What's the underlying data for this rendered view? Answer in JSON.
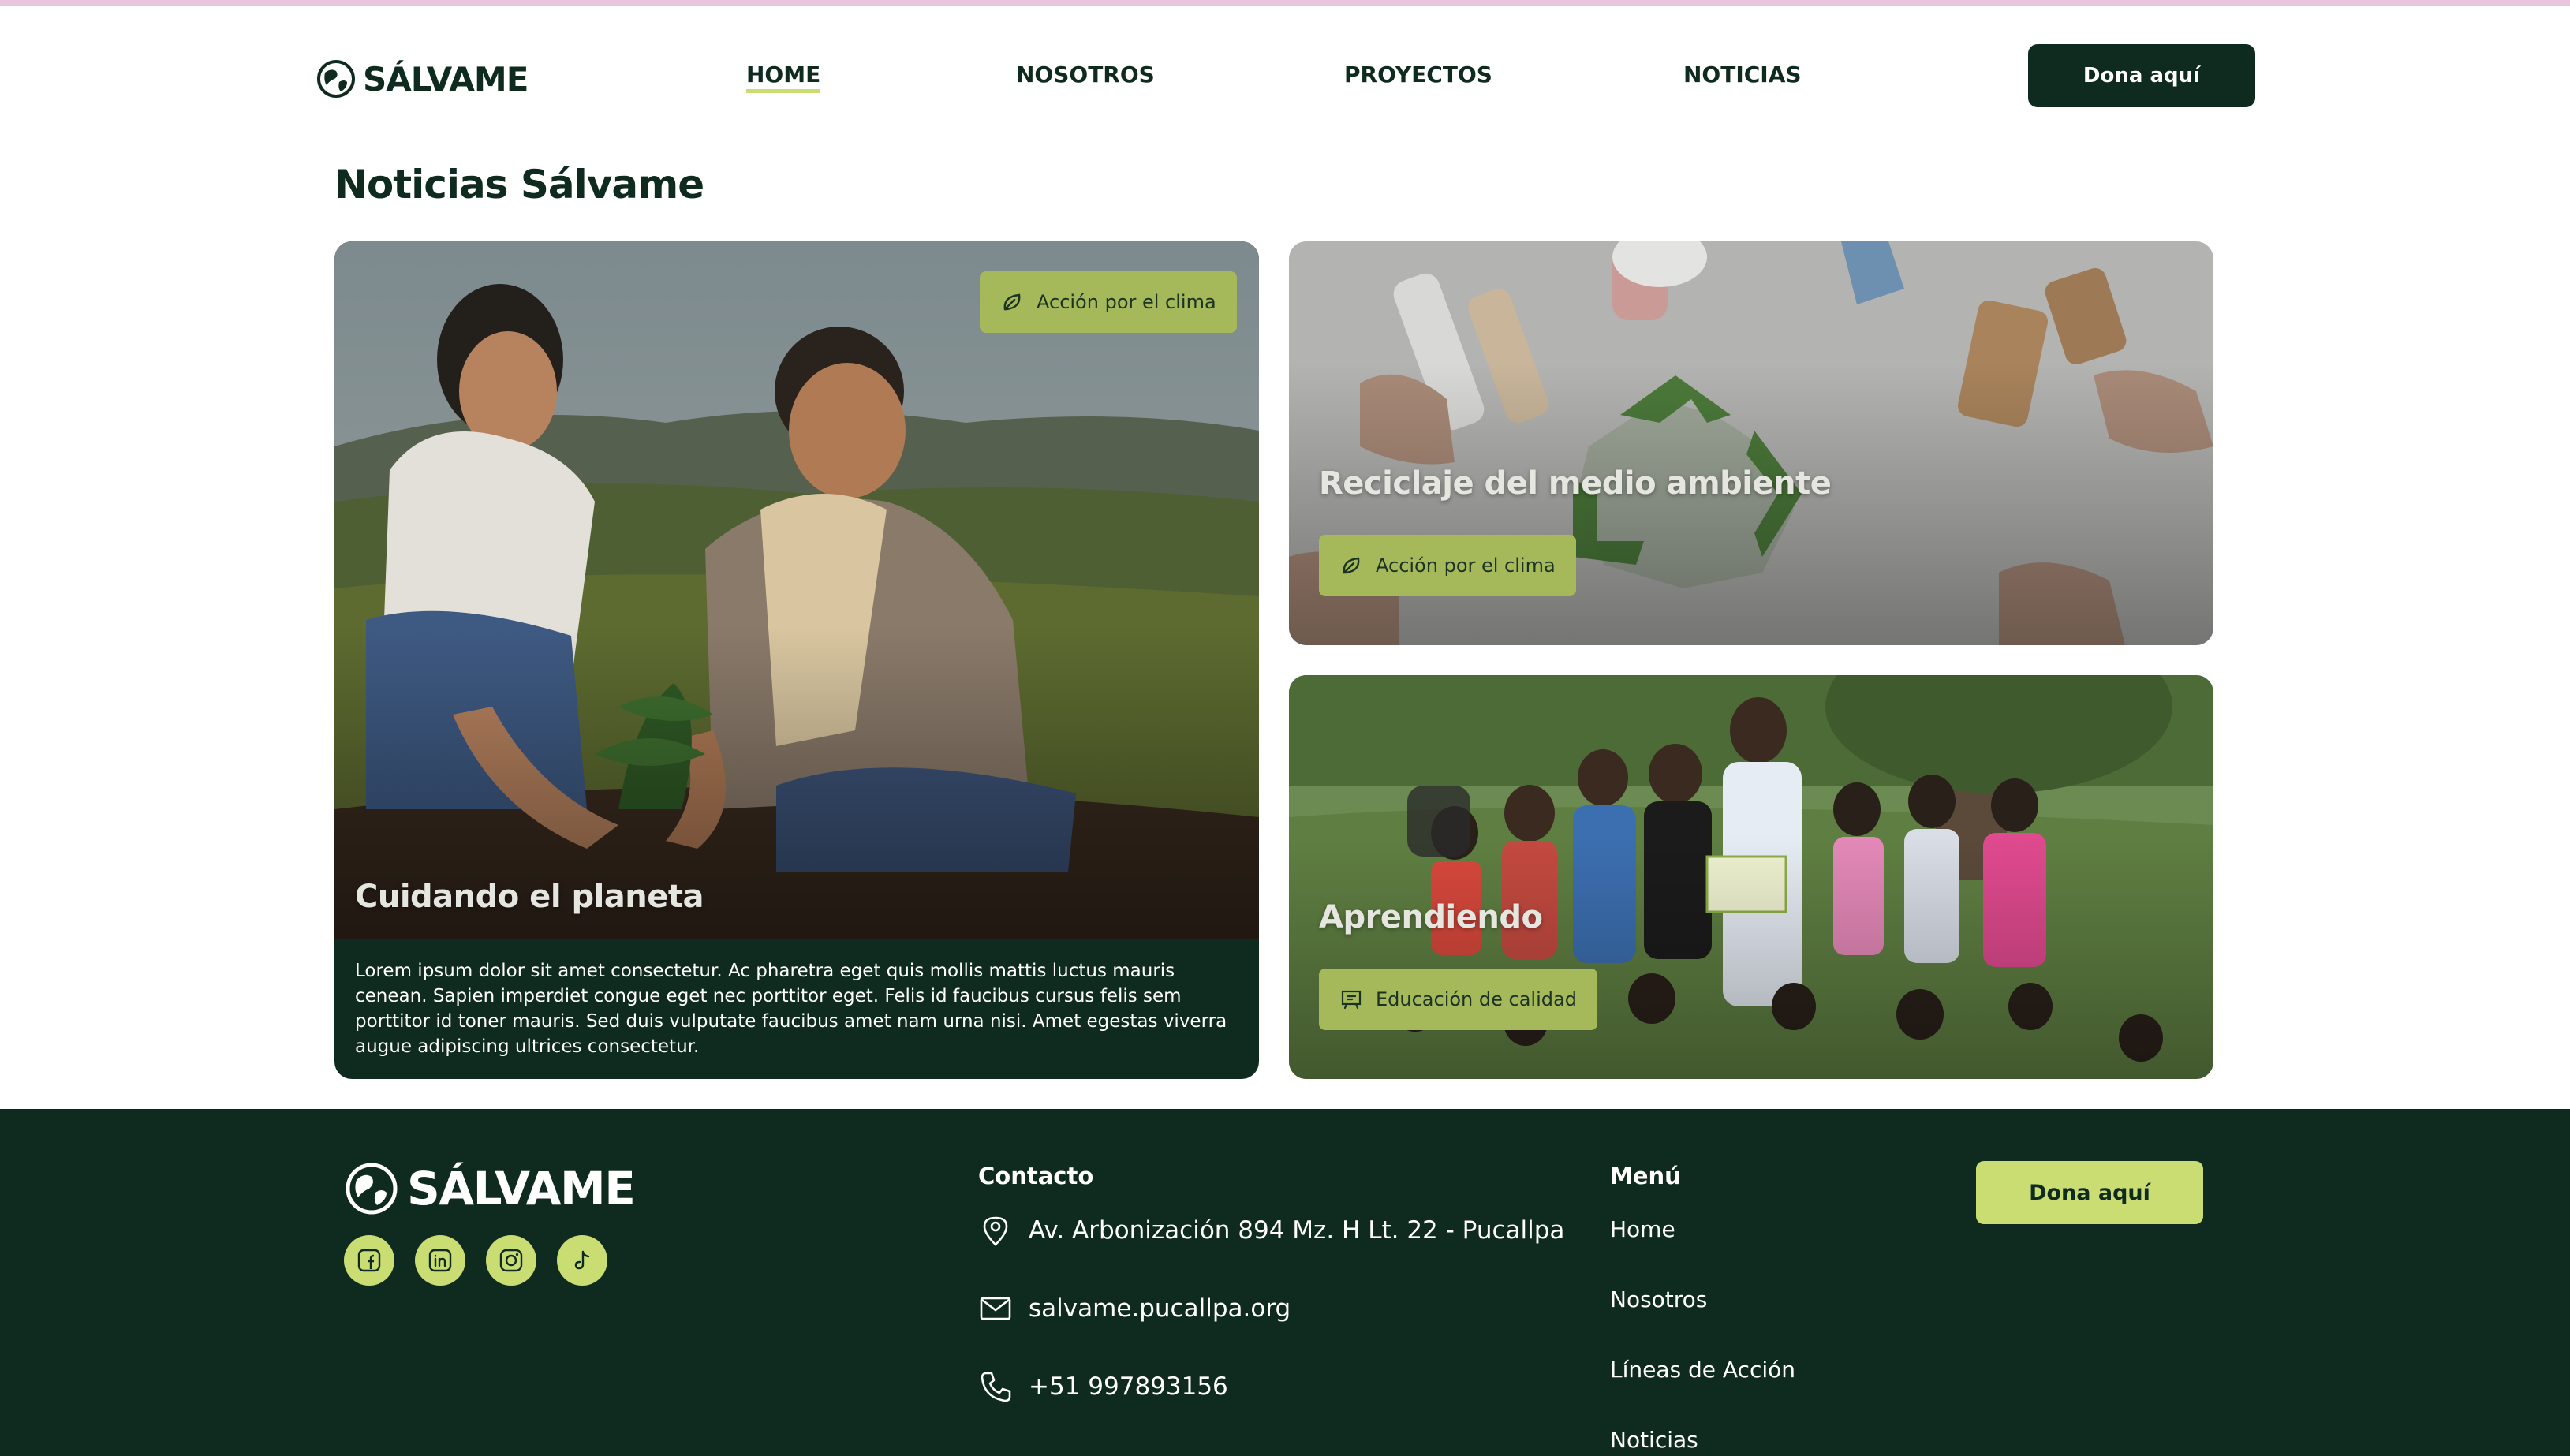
{
  "brand": {
    "name": "SÁLVAME",
    "logo_icon": "globe-hands-icon"
  },
  "nav": {
    "items": [
      {
        "label": "HOME",
        "active": true
      },
      {
        "label": "NOSOTROS",
        "active": false
      },
      {
        "label": "PROYECTOS",
        "active": false
      },
      {
        "label": "NOTICIAS",
        "active": false
      }
    ],
    "donate_label": "Dona aquí"
  },
  "page": {
    "title": "Noticias Sálvame"
  },
  "news": [
    {
      "title": "Cuidando el planeta",
      "tag": "Acción por el clima",
      "tag_icon": "leaf-icon",
      "body": "Lorem ipsum dolor sit amet consectetur. Ac pharetra eget quis mollis mattis luctus mauris cenean. Sapien imperdiet congue eget nec porttitor eget. Felis id faucibus cursus felis sem porttitor id toner mauris. Sed duis vulputate faucibus amet nam urna nisi. Amet egestas viverra augue adipiscing ultrices consectetur."
    },
    {
      "title": "Reciclaje del medio ambiente",
      "tag": "Acción por el clima",
      "tag_icon": "leaf-icon"
    },
    {
      "title": "Aprendiendo",
      "tag": "Educación de calidad",
      "tag_icon": "classroom-icon"
    }
  ],
  "footer": {
    "brand": "SÁLVAME",
    "socials": [
      "facebook-icon",
      "linkedin-icon",
      "instagram-icon",
      "tiktok-icon"
    ],
    "contact_heading": "Contacto",
    "address": "Av. Arbonización 894 Mz. H Lt. 22 - Pucallpa",
    "email": "salvame.pucallpa.org",
    "phone": "+51 997893156",
    "menu_heading": "Menú",
    "menu": [
      "Home",
      "Nosotros",
      "Líneas de Acción",
      "Noticias"
    ],
    "donate_label": "Dona aquí"
  },
  "colors": {
    "primary_dark": "#0f2a1f",
    "accent_lime": "#c9dd73",
    "tag_green": "#a5b85a",
    "top_strip": "#e9c6dd"
  }
}
